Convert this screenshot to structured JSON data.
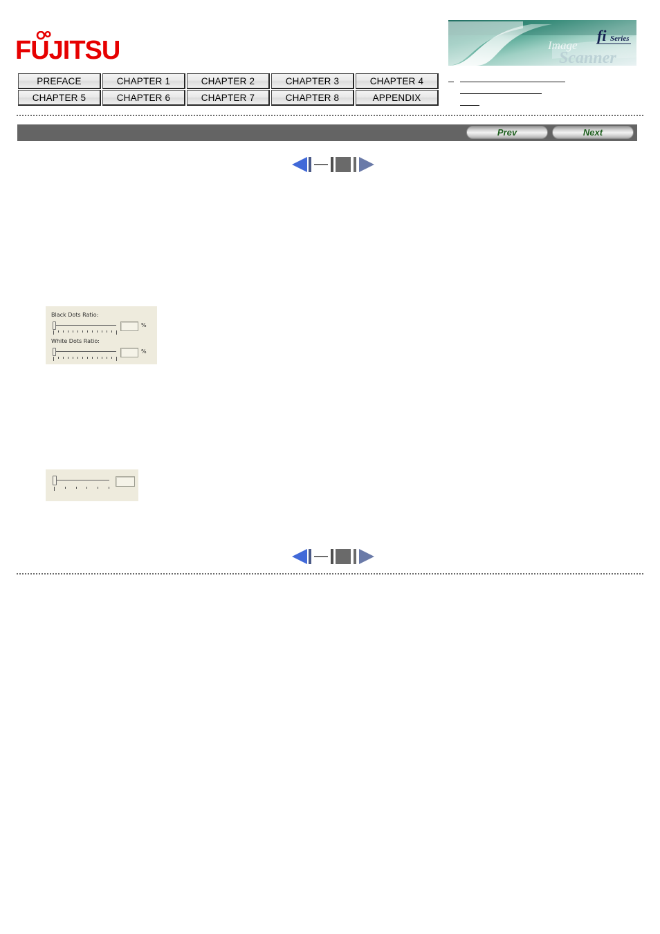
{
  "header": {
    "brand": "FUJITSU",
    "banner": {
      "series_fi": "fi",
      "series_word": "Series",
      "product_line1": "Image",
      "product_line2": "Scanner"
    }
  },
  "tabs": {
    "row1": [
      {
        "label": "PREFACE",
        "name": "tab-preface"
      },
      {
        "label": "CHAPTER 1",
        "name": "tab-chapter-1"
      },
      {
        "label": "CHAPTER 2",
        "name": "tab-chapter-2"
      },
      {
        "label": "CHAPTER 3",
        "name": "tab-chapter-3"
      },
      {
        "label": "CHAPTER 4",
        "name": "tab-chapter-4"
      }
    ],
    "row2": [
      {
        "label": "CHAPTER 5",
        "name": "tab-chapter-5"
      },
      {
        "label": "CHAPTER 6",
        "name": "tab-chapter-6"
      },
      {
        "label": "CHAPTER 7",
        "name": "tab-chapter-7"
      },
      {
        "label": "CHAPTER 8",
        "name": "tab-chapter-8"
      },
      {
        "label": "APPENDIX",
        "name": "tab-appendix"
      }
    ]
  },
  "navbar": {
    "prev_label": "Prev",
    "next_label": "Next"
  },
  "pager": {
    "first_label": "",
    "prev_label": "",
    "current_label": "",
    "next_label": "",
    "last_label": ""
  },
  "figures": {
    "dots_ratio": {
      "black_label": "Black Dots Ratio:",
      "black_value": "",
      "black_unit": "%",
      "white_label": "White Dots Ratio:",
      "white_value": "",
      "white_unit": "%"
    },
    "single_slider": {
      "value": ""
    }
  },
  "colors": {
    "brand_red": "#e60000",
    "navbar_gray": "#646464",
    "button_green": "#1d5e1d",
    "pager_blue": "#4169d8",
    "pager_slate": "#6a7aa8",
    "dialog_bg": "#eeebdd"
  }
}
